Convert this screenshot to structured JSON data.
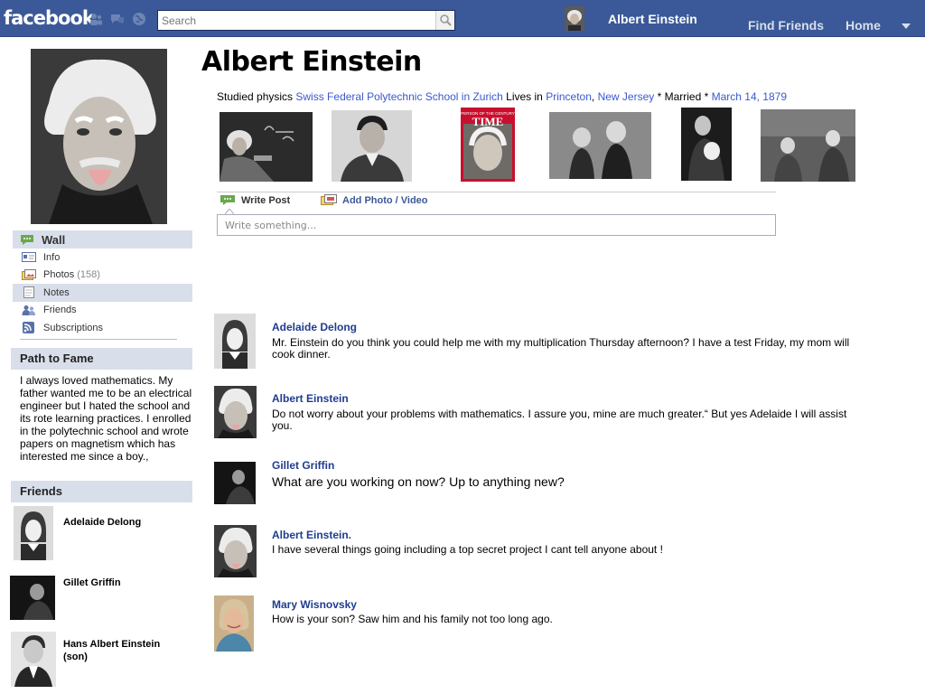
{
  "topbar": {
    "logo": "facebook",
    "search_placeholder": "Search",
    "user_name": "Albert Einstein",
    "nav_find_friends": "Find Friends",
    "nav_home": "Home",
    "bar_color": "#3b5998"
  },
  "left": {
    "nav": {
      "wall": "Wall",
      "info": "Info",
      "photos": "Photos",
      "photos_count": "(158)",
      "notes": "Notes",
      "friends": "Friends",
      "subscriptions": "Subscriptions"
    },
    "path_title": "Path to Fame",
    "path_text": "I always loved mathematics. My father wanted me to be an electrical engineer but I hated the school and its rote learning practices. I enrolled in the polytechnic school and wrote papers on magnetism which has interested me since a boy.,",
    "friends_title": "Friends",
    "friends": [
      {
        "name": "Adelaide Delong"
      },
      {
        "name": "Gillet Griffin"
      },
      {
        "name": "Hans Albert Einstein (son)"
      }
    ]
  },
  "profile": {
    "name": "Albert Einstein",
    "info": {
      "studied_prefix": "Studied physics ",
      "school": "Swiss Federal Polytechnic School in Zurich",
      "lives_prefix": "  Lives in ",
      "city": "Princeton",
      "sep": ", ",
      "state": "New Jersey",
      "married": " * Married * ",
      "date": "March 14, 1879"
    },
    "time_cover_title": "TIME",
    "time_cover_banner": "PERSON OF THE CENTURY"
  },
  "composer": {
    "write_post": "Write Post",
    "add_photo": "Add Photo / Video",
    "placeholder": "Write something..."
  },
  "posts": [
    {
      "author": "Adelaide Delong",
      "text": "Mr. Einstein do you think you could help me with my multiplication Thursday afternoon? I have a test Friday, my mom will cook dinner."
    },
    {
      "author": "Albert Einstein",
      "text": "Do not worry about your problems with mathematics. I assure you, mine are much greater.“ But yes Adelaide I will assist you."
    },
    {
      "author": "Gillet Griffin",
      "text": "What are you working on  now? Up to anything new?"
    },
    {
      "author": "Albert Einstein.",
      "text": "I have several things going including a top secret project I cant tell anyone about !"
    },
    {
      "author": "Mary Wisnovsky",
      "text": "How is your son? Saw him and his family  not too long ago."
    }
  ]
}
